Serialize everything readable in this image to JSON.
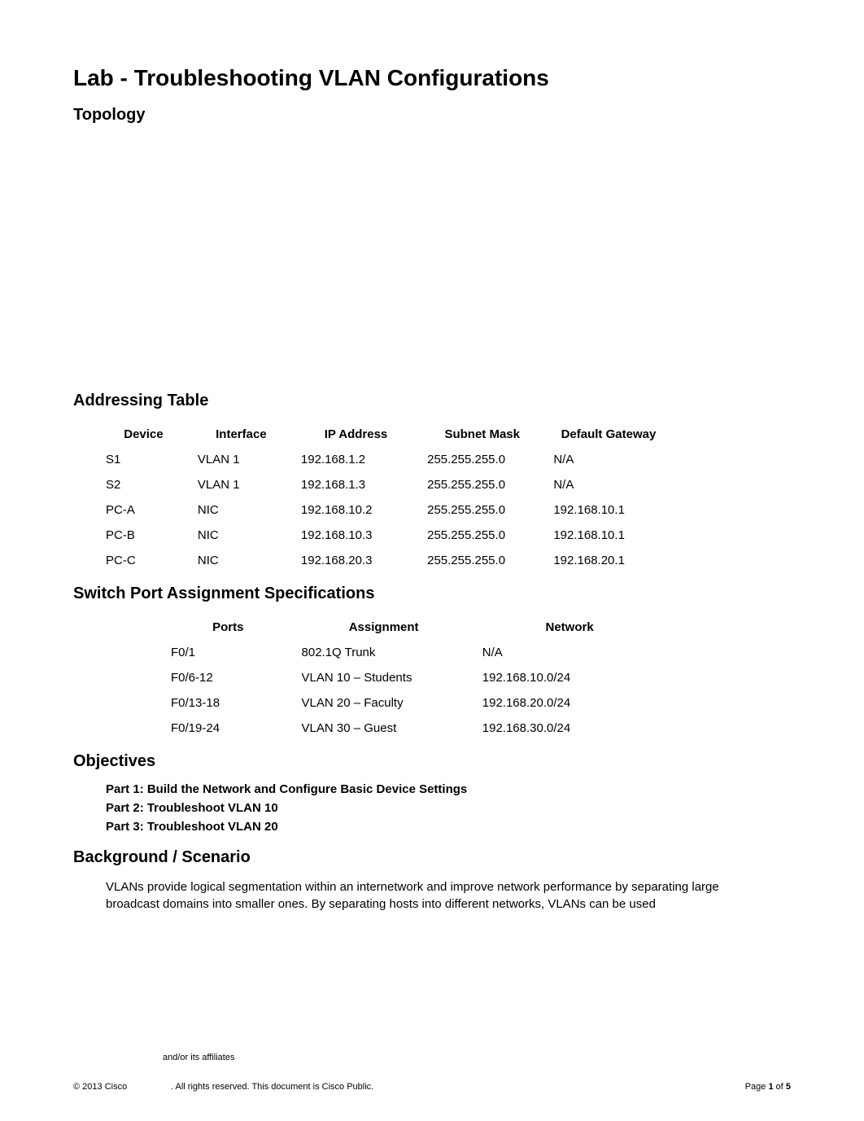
{
  "title": "Lab - Troubleshooting VLAN Configurations",
  "sections": {
    "topology": "Topology",
    "addressing": "Addressing Table",
    "switchport": "Switch Port Assignment Specifications",
    "objectives": "Objectives",
    "background": "Background / Scenario"
  },
  "addressing_table": {
    "headers": [
      "Device",
      "Interface",
      "IP Address",
      "Subnet Mask",
      "Default Gateway"
    ],
    "rows": [
      {
        "device": "S1",
        "interface": "VLAN 1",
        "ip": "192.168.1.2",
        "mask": "255.255.255.0",
        "gw": "N/A"
      },
      {
        "device": "S2",
        "interface": "VLAN 1",
        "ip": "192.168.1.3",
        "mask": "255.255.255.0",
        "gw": "N/A"
      },
      {
        "device": "PC-A",
        "interface": "NIC",
        "ip": "192.168.10.2",
        "mask": "255.255.255.0",
        "gw": "192.168.10.1"
      },
      {
        "device": "PC-B",
        "interface": "NIC",
        "ip": "192.168.10.3",
        "mask": "255.255.255.0",
        "gw": "192.168.10.1"
      },
      {
        "device": "PC-C",
        "interface": "NIC",
        "ip": "192.168.20.3",
        "mask": "255.255.255.0",
        "gw": "192.168.20.1"
      }
    ]
  },
  "switchport_table": {
    "headers": [
      "Ports",
      "Assignment",
      "Network"
    ],
    "rows": [
      {
        "ports": "F0/1",
        "assignment": "802.1Q Trunk",
        "network": "N/A"
      },
      {
        "ports": "F0/6-12",
        "assignment": "VLAN 10 – Students",
        "network": "192.168.10.0/24"
      },
      {
        "ports": "F0/13-18",
        "assignment": "VLAN 20 – Faculty",
        "network": "192.168.20.0/24"
      },
      {
        "ports": "F0/19-24",
        "assignment": "VLAN 30 – Guest",
        "network": "192.168.30.0/24"
      }
    ]
  },
  "objectives": {
    "part1": "Part 1: Build the Network and Configure Basic Device Settings",
    "part2": "Part 2: Troubleshoot VLAN 10",
    "part3": "Part 3: Troubleshoot VLAN 20"
  },
  "background_text": "VLANs provide logical segmentation within an internetwork and improve network performance by separating large broadcast domains into smaller ones. By separating hosts into different networks, VLANs can be used",
  "affiliates": "and/or its affiliates",
  "footer": {
    "left": "© 2013 Cisco",
    "mid": ". All rights reserved. This document is Cisco Public.",
    "page_label": "Page ",
    "page_num": "1",
    "page_of": " of ",
    "page_total": "5"
  }
}
